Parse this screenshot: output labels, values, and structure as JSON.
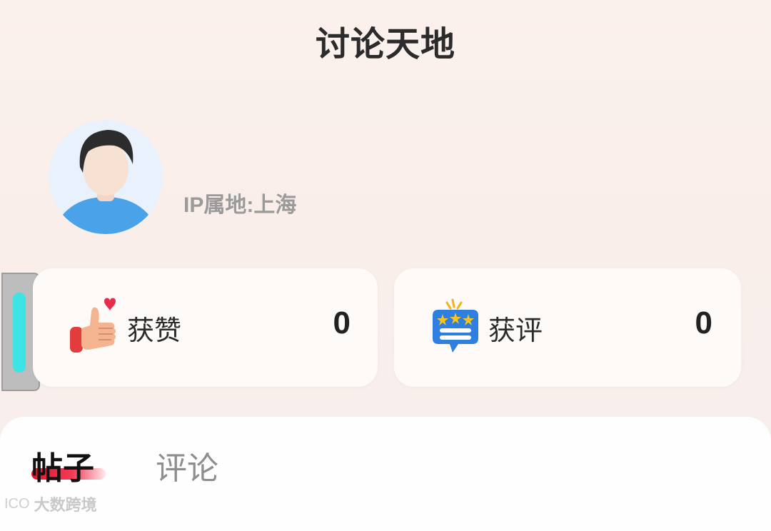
{
  "header": {
    "title": "讨论天地"
  },
  "profile": {
    "ip_location": "IP属地:上海",
    "avatar_icon": "user-avatar-icon"
  },
  "stats": {
    "likes": {
      "label": "获赞",
      "count": "0",
      "icon": "thumbs-up-heart-icon"
    },
    "reviews": {
      "label": "获评",
      "count": "0",
      "icon": "star-chat-icon"
    }
  },
  "tabs": [
    {
      "label": "帖子",
      "active": true
    },
    {
      "label": "评论",
      "active": false
    }
  ],
  "watermark": {
    "logo": "ICO",
    "text": "大数跨境"
  },
  "colors": {
    "accent": "#e8122c",
    "handle": "#3ee3e5",
    "background": "#fbf1ec"
  }
}
